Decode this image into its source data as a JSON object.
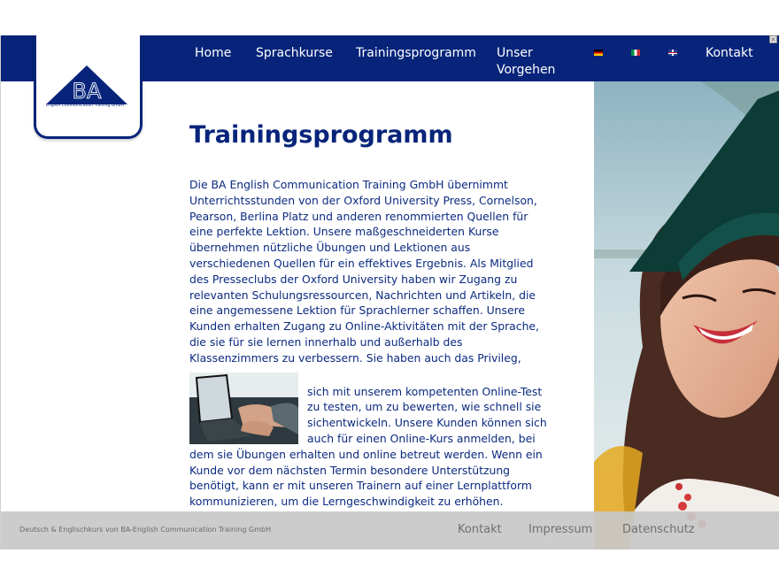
{
  "nav": {
    "home": "Home",
    "courses": "Sprachkurse",
    "training": "Trainingsprogramm",
    "approach_line1": "Unser",
    "approach_line2": "Vorgehen",
    "contact": "Kontakt"
  },
  "languages": [
    "Deutsch",
    "Italiano",
    "English"
  ],
  "logo": {
    "letters": "BA",
    "company": "English Communication Training GmbH",
    "tagline": "Lifelong Learning · Communication · Coaching"
  },
  "page": {
    "title": "Trainingsprogramm",
    "para1": "Die BA English Communication Training GmbH übernimmt Unterrichtsstunden von der Oxford University Press, Cornelson, Pearson, Berlina Platz und anderen renommierten Quellen für eine perfekte Lektion. Unsere maßgeschneiderten Kurse übernehmen nützliche Übungen und Lektionen aus verschiedenen Quellen für ein effektives Ergebnis. Als Mitglied des Presseclubs der Oxford University haben wir Zugang zu relevanten Schulungsressourcen, Nachrichten und Artikeln, die eine angemessene Lektion für Sprachlerner schaffen. Unsere",
    "para2": "Kunden erhalten Zugang zu Online-Aktivitäten mit der Sprache, die sie für sie lernen innerhalb und außerhalb des Klassenzimmers zu verbessern. Sie haben auch das Privileg,",
    "para3": "sich mit unserem kompetenten Online-Test zu testen, um zu bewerten, wie schnell sie sichentwickeln. Unsere Kunden können sich auch für einen Online-Kurs anmelden, bei dem sie Übungen erhalten und online betreut werden. Wenn ein Kunde vor dem nächsten Termin besondere Unterstützung benötigt, kann er mit unseren Trainern auf einer Lernplattform kommunizieren, um die Lerngeschwindigkeit zu erhöhen."
  },
  "footer": {
    "copyright": "Deutsch & Englischkurs von BA-English Communication Training GmbH",
    "contact": "Kontakt",
    "imprint": "Impressum",
    "privacy": "Datenschutz"
  },
  "colors": {
    "brand_navy": "#07247a",
    "footer_gray": "#c8c8c8",
    "text_blue": "#0b2a80"
  },
  "icons": {
    "close": "close-icon",
    "flag_de": "german-flag-icon",
    "flag_it": "italian-flag-icon",
    "flag_uk": "uk-flag-icon"
  }
}
